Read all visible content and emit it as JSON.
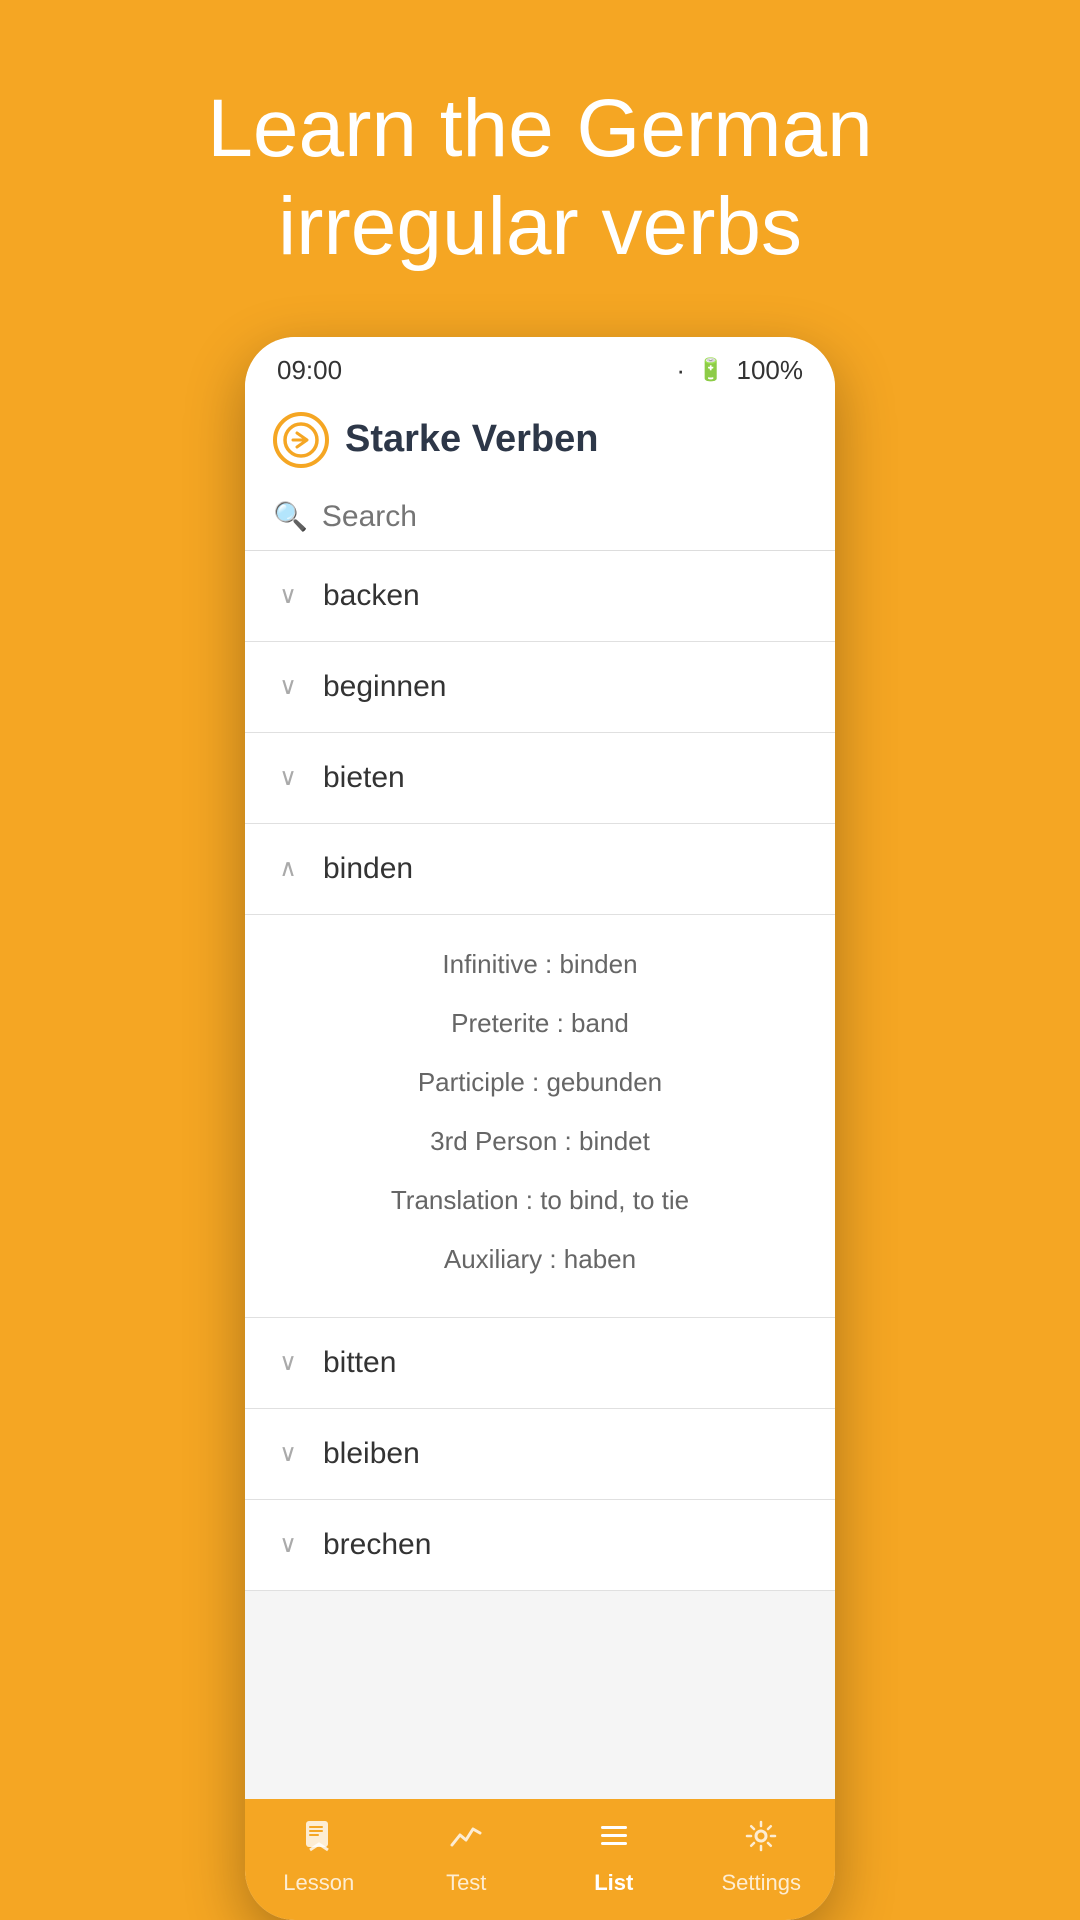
{
  "hero": {
    "title": "Learn the German irregular verbs"
  },
  "status_bar": {
    "time": "09:00",
    "signal": "·",
    "battery": "100%"
  },
  "app": {
    "title": "Starke Verben"
  },
  "search": {
    "placeholder": "Search"
  },
  "verbs": [
    {
      "id": 1,
      "name": "backen",
      "expanded": false
    },
    {
      "id": 2,
      "name": "beginnen",
      "expanded": false
    },
    {
      "id": 3,
      "name": "bieten",
      "expanded": false
    },
    {
      "id": 4,
      "name": "binden",
      "expanded": true,
      "details": [
        {
          "label": "Infinitive",
          "value": "binden"
        },
        {
          "label": "Preterite",
          "value": "band"
        },
        {
          "label": "Participle",
          "value": "gebunden"
        },
        {
          "label": "3rd Person",
          "value": "bindet"
        },
        {
          "label": "Translation",
          "value": "to bind, to tie"
        },
        {
          "label": "Auxiliary",
          "value": "haben"
        }
      ]
    },
    {
      "id": 5,
      "name": "bitten",
      "expanded": false
    },
    {
      "id": 6,
      "name": "bleiben",
      "expanded": false
    },
    {
      "id": 7,
      "name": "brechen",
      "expanded": false
    }
  ],
  "nav": {
    "items": [
      {
        "id": "lesson",
        "label": "Lesson",
        "icon": "📖",
        "active": false
      },
      {
        "id": "test",
        "label": "Test",
        "icon": "📈",
        "active": false
      },
      {
        "id": "list",
        "label": "List",
        "icon": "☰",
        "active": true
      },
      {
        "id": "settings",
        "label": "Settings",
        "icon": "⚙️",
        "active": false
      }
    ]
  }
}
